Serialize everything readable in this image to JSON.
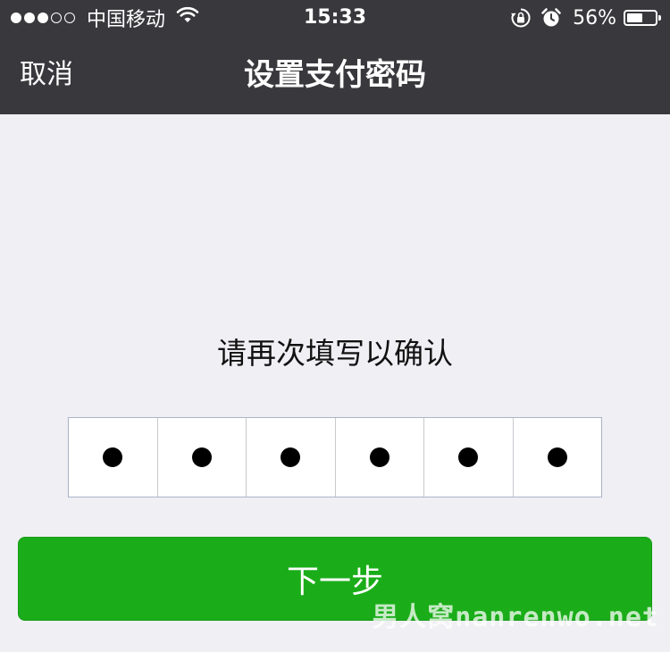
{
  "status_bar": {
    "signal": {
      "filled": 3,
      "total": 5
    },
    "carrier": "中国移动",
    "time": "15:33",
    "battery_percent_text": "56%",
    "battery_level": 0.56,
    "icons": [
      "wifi-icon",
      "orientation-lock-icon",
      "alarm-icon",
      "battery-icon"
    ]
  },
  "nav": {
    "cancel_label": "取消",
    "title": "设置支付密码"
  },
  "main": {
    "prompt": "请再次填写以确认",
    "pin": {
      "length": 6,
      "filled": 6
    }
  },
  "footer": {
    "next_label": "下一步"
  },
  "watermark": "男人窝nanrenwo.net",
  "colors": {
    "header_bg": "#39393d",
    "page_bg": "#efeff4",
    "button_green": "#1aad19",
    "pin_border": "#a9b4c6"
  }
}
